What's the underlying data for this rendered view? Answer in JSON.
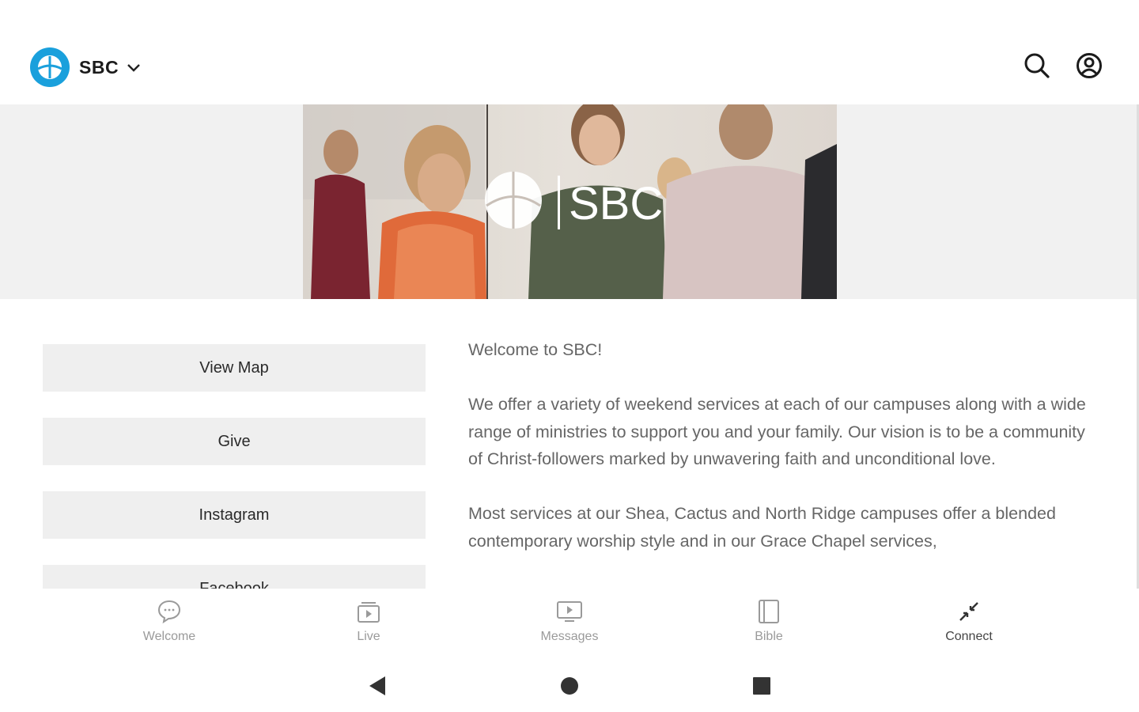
{
  "header": {
    "brand_name": "SBC",
    "icons": [
      "church-logo-icon",
      "chevron-down-icon",
      "search-icon",
      "account-icon"
    ]
  },
  "hero": {
    "logo_text": "SBC"
  },
  "links": [
    {
      "label": "View Map"
    },
    {
      "label": "Give"
    },
    {
      "label": "Instagram"
    },
    {
      "label": "Facebook"
    }
  ],
  "content": {
    "paragraphs": [
      "Welcome to SBC!",
      "We offer a variety of weekend services at each of our campuses along with a wide range of ministries to support you and your family. Our vision is to be a community of Christ-followers marked by unwavering faith and unconditional love.",
      "Most services at our Shea, Cactus and North Ridge campuses offer a blended contemporary worship style and in our Grace Chapel services,"
    ]
  },
  "bottom_nav": {
    "items": [
      {
        "label": "Welcome",
        "icon": "chat-bubble-icon"
      },
      {
        "label": "Live",
        "icon": "live-video-icon"
      },
      {
        "label": "Messages",
        "icon": "tv-play-icon"
      },
      {
        "label": "Bible",
        "icon": "book-icon"
      },
      {
        "label": "Connect",
        "icon": "connect-arrows-icon"
      }
    ],
    "active": "Connect"
  },
  "system_nav": {
    "icons": [
      "back-icon",
      "home-icon",
      "recents-icon"
    ]
  },
  "colors": {
    "brand_blue": "#1aa0dc",
    "band_gray": "#f1f1f1",
    "button_gray": "#efefef",
    "text_gray": "#666666"
  }
}
